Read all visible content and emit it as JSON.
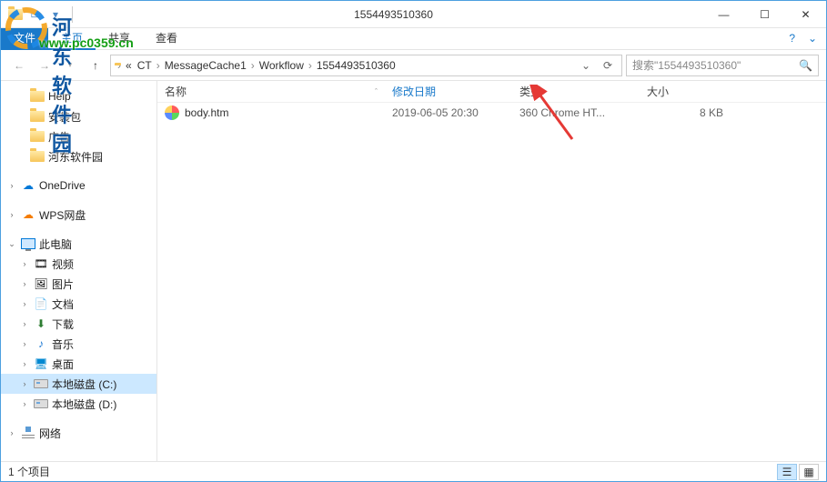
{
  "window": {
    "title": "1554493510360"
  },
  "watermark": {
    "text": "河东软件园",
    "url": "www.pc0359.cn"
  },
  "ribbon": {
    "file": "文件",
    "tabs": [
      "主页",
      "共享",
      "查看"
    ]
  },
  "breadcrumbs": {
    "parts": [
      "CT",
      "MessageCache1",
      "Workflow",
      "1554493510360"
    ]
  },
  "search": {
    "placeholder": "搜索\"1554493510360\""
  },
  "nav": {
    "quick": [
      {
        "label": "Help"
      },
      {
        "label": "安装包"
      },
      {
        "label": "广告"
      },
      {
        "label": "河东软件园"
      }
    ],
    "onedrive": "OneDrive",
    "wps": "WPS网盘",
    "thispc": "此电脑",
    "pcitems": [
      {
        "label": "视频"
      },
      {
        "label": "图片"
      },
      {
        "label": "文档"
      },
      {
        "label": "下载"
      },
      {
        "label": "音乐"
      },
      {
        "label": "桌面"
      },
      {
        "label": "本地磁盘 (C:)"
      },
      {
        "label": "本地磁盘 (D:)"
      }
    ],
    "network": "网络"
  },
  "columns": {
    "name": "名称",
    "date": "修改日期",
    "type": "类型",
    "size": "大小"
  },
  "files": [
    {
      "name": "body.htm",
      "date": "2019-06-05 20:30",
      "type": "360 Chrome HT...",
      "size": "8 KB"
    }
  ],
  "status": {
    "count": "1 个项目"
  }
}
